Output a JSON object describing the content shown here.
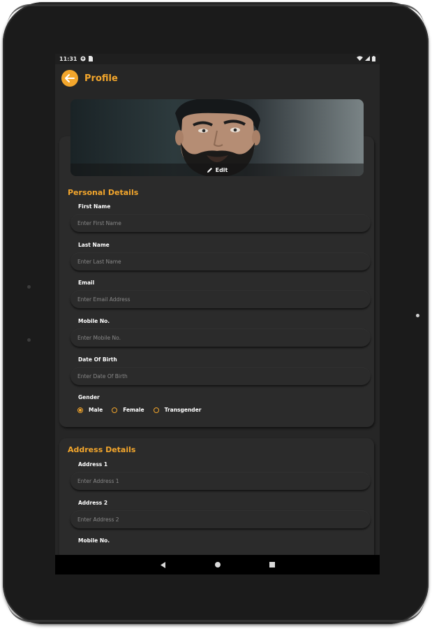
{
  "statusbar": {
    "time": "11:31"
  },
  "appbar": {
    "title": "Profile"
  },
  "banner": {
    "edit_label": "Edit"
  },
  "personal": {
    "title": "Personal Details",
    "fields": [
      {
        "label": "First Name",
        "placeholder": "Enter First Name"
      },
      {
        "label": "Last Name",
        "placeholder": "Enter Last Name"
      },
      {
        "label": "Email",
        "placeholder": "Enter Email Address"
      },
      {
        "label": "Mobile No.",
        "placeholder": "Enter Mobile No."
      },
      {
        "label": "Date Of Birth",
        "placeholder": "Enter Date Of Birth"
      }
    ],
    "gender": {
      "label": "Gender",
      "options": [
        "Male",
        "Female",
        "Transgender"
      ],
      "selected": "Male"
    }
  },
  "address": {
    "title": "Address Details",
    "fields": [
      {
        "label": "Address 1",
        "placeholder": "Enter Address 1"
      },
      {
        "label": "Address 2",
        "placeholder": "Enter Address 2"
      },
      {
        "label": "Mobile No."
      }
    ]
  },
  "colors": {
    "accent": "#f3a62c",
    "background": "#262626",
    "card": "#2b2b2b"
  }
}
